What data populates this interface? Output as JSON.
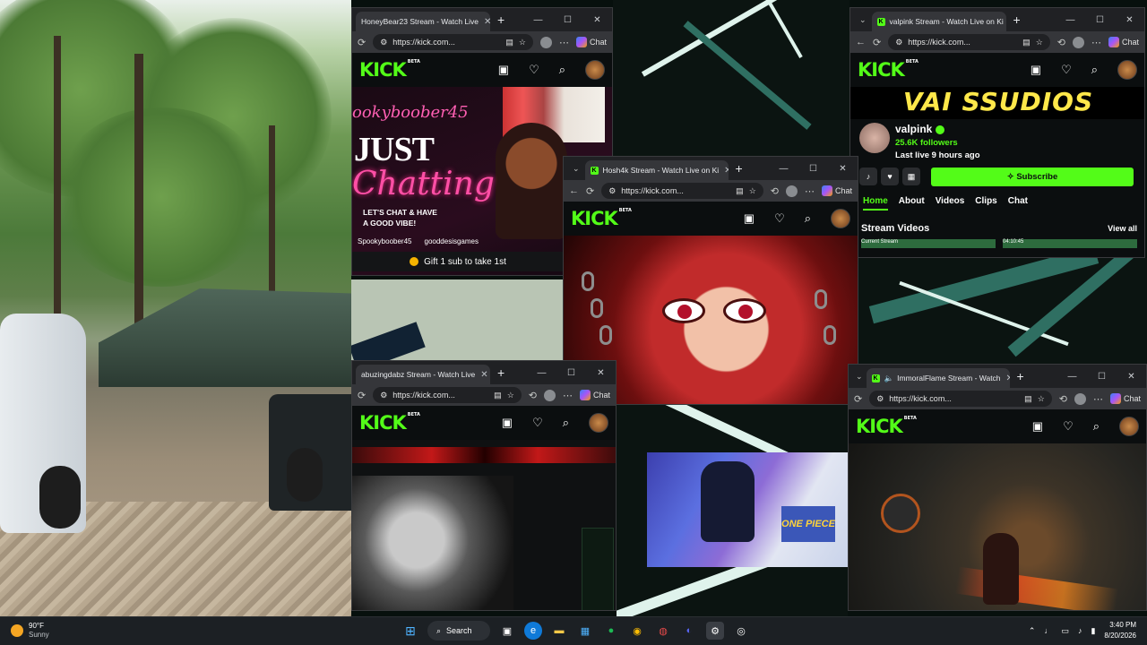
{
  "taskbar": {
    "weather_temp": "90°F",
    "weather_desc": "Sunny",
    "search_label": "Search",
    "time": "3:40 PM",
    "date": "8/20/2026"
  },
  "windows": {
    "honeybear": {
      "tab_title": "HoneyBear23 Stream - Watch Live",
      "url": "https://kick.com...",
      "chat_label": "Chat",
      "overlay_name": "ookyboober45",
      "overlay_just": "JUST",
      "overlay_chatting": "Chatting",
      "overlay_sub": "LET'S CHAT & HAVE\nA GOOD VIBE!",
      "social_1": "Spookyboober45",
      "social_2": "gooddesisgames",
      "gift_text": "Gift 1 sub to take 1st"
    },
    "valpink": {
      "tab_title": "valpink Stream - Watch Live on Ki",
      "url": "https://kick.com...",
      "chat_label": "Chat",
      "banner": "VAI SSUDIOS",
      "name": "valpink",
      "followers": "25.6K followers",
      "last_live": "Last live 9 hours ago",
      "subscribe": "Subscribe",
      "tabs": [
        "Home",
        "About",
        "Videos",
        "Clips",
        "Chat"
      ],
      "stream_videos": "Stream Videos",
      "view_all": "View all",
      "thumb_1": "Current Stream",
      "thumb_2": "04:10:45"
    },
    "hoshi": {
      "tab_title": "Hosh4k Stream - Watch Live on Ki",
      "url": "https://kick.com...",
      "chat_label": "Chat"
    },
    "abuzing": {
      "tab_title": "abuzingdabz Stream - Watch Live",
      "url": "https://kick.com...",
      "chat_label": "Chat"
    },
    "immoral": {
      "tab_title": "ImmoralFlame Stream - Watch",
      "url": "https://kick.com...",
      "chat_label": "Chat"
    }
  },
  "kick": {
    "logo": "KICK",
    "beta": "BETA"
  },
  "room_cam": {
    "poster_text": "ONE PIECE"
  }
}
